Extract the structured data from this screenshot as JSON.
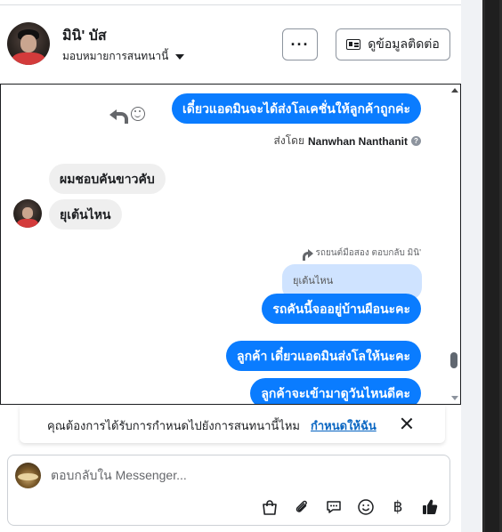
{
  "header": {
    "contact_name": "มินิ' บัส",
    "assign_label": "มอบหมายการสนทนานี้",
    "more_label": "···",
    "info_button_label": "ดูข้อมูลติดต่อ"
  },
  "messages": {
    "m1_text": "เดี๋ยวแอดมินจะได้ส่งโลเคชั่นให้ลูกค้าถูกค่ะ",
    "m1_sent_by_prefix": "ส่งโดย",
    "m1_sent_by_name": "Nanwhan Nanthanit",
    "m2_text": "ผมชอบคันขาวคับ",
    "m3_text": "ยุเต้นไหน",
    "reply_meta": "รถยนต์มือสอง ตอบกลับ มินิ'",
    "quoted_text": "ยุเต้นไหน",
    "m4_text": "รถคันนี้จออยู่บ้านผือนะคะ",
    "m5_text": "ลูกค้า เดี๋ยวแอดมินส่งโลให้นะคะ",
    "m6_text": "ลูกค้าจะเข้ามาดูวันไหนดีคะ"
  },
  "prompt": {
    "text": "คุณต้องการได้รับการกำหนดไปยังการสนทนานี้ไหม",
    "link": "กำหนดให้ฉัน"
  },
  "composer": {
    "placeholder": "ตอบกลับใน Messenger...",
    "baht_symbol": "฿"
  },
  "colors": {
    "outgoing_bubble": "#0a7cff",
    "incoming_bubble": "#efefef",
    "quoted_bubble": "#cfe3ff",
    "link": "#0a66c2"
  },
  "icons": [
    "reply-icon",
    "smile-icon",
    "help-icon",
    "share-arrow-icon",
    "close-icon",
    "shopping-bag-icon",
    "paperclip-icon",
    "chat-bubble-icon",
    "emoji-icon",
    "baht-icon",
    "thumbs-up-icon"
  ]
}
